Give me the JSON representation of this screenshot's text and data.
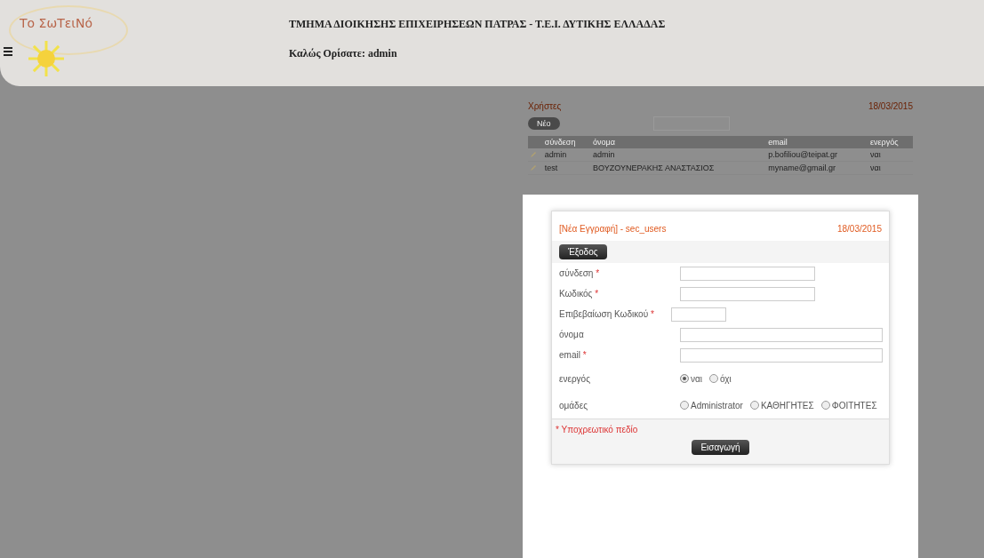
{
  "header": {
    "logo": "Το ΣωΤειΝό",
    "title": "ΤΜΗΜΑ ΔΙΟΙΚΗΣΗΣ ΕΠΙΧΕΙΡΗΣΕΩΝ ΠΑΤΡΑΣ - Τ.Ε.Ι. ΔΥΤΙΚΗΣ ΕΛΛΑΔΑΣ",
    "welcome": "Καλώς Ορίσατε: admin"
  },
  "list": {
    "title": "Χρήστες",
    "date": "18/03/2015",
    "new_button": "Νέο",
    "columns": [
      "σύνδεση",
      "όνομα",
      "email",
      "ενεργός"
    ],
    "rows": [
      [
        "admin",
        "admin",
        "p.bofiliou@teipat.gr",
        "ναι"
      ],
      [
        "test",
        "ΒΟΥΖΟΥΝΕΡΑΚΗΣ ΑΝΑΣΤΑΣΙΟΣ",
        "myname@gmail.gr",
        "ναι"
      ]
    ]
  },
  "dialog": {
    "title": "[Νέα Εγγραφή] - sec_users",
    "date": "18/03/2015",
    "exit_button": "Έξοδος",
    "fields": [
      {
        "kind": "field",
        "label": "σύνδεση",
        "marker": "*"
      },
      {
        "kind": "field",
        "label": "Κωδικός",
        "marker": "*"
      },
      {
        "kind": "shortfield",
        "label": "Επιβεβαίωση Κωδικού",
        "marker": "*"
      },
      {
        "kind": "widefield",
        "label": "όνομα"
      },
      {
        "kind": "widefield",
        "label": "email",
        "marker": "*"
      },
      {
        "kind": "radio",
        "label": "ενεργός",
        "options": [
          {
            "label": "ναι",
            "selected": true
          },
          {
            "label": "όχι",
            "selected": false
          }
        ]
      },
      {
        "kind": "radio",
        "label": "ομάδες",
        "options": [
          {
            "label": "Administrator",
            "selected": false
          },
          {
            "label": "ΚΑΘΗΓΗΤΕΣ",
            "selected": false
          },
          {
            "label": "ΦΟΙΤΗΤΕΣ",
            "selected": false
          }
        ]
      }
    ],
    "required_note": "* Υποχρεωτικό πεδίο",
    "submit_button": "Εισαγωγή"
  }
}
